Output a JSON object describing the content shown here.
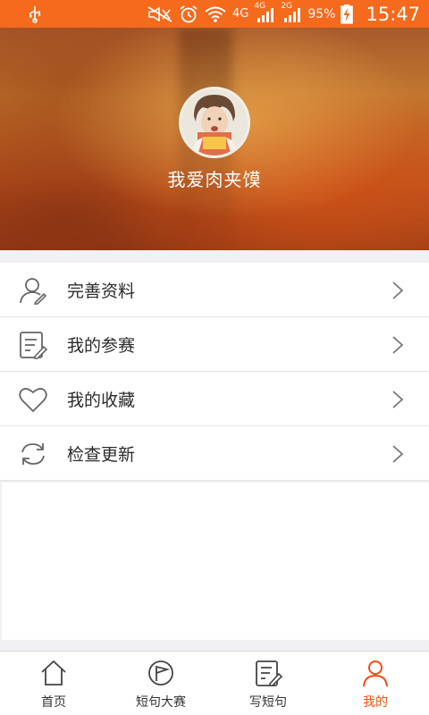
{
  "status_bar": {
    "network_4g_main": "4G",
    "sim1_label": "4G",
    "sim2_label": "2G",
    "battery": "95%",
    "time": "15:47",
    "color": "#f56a1c"
  },
  "profile": {
    "username": "我爱肉夹馍"
  },
  "menu": {
    "items": [
      {
        "label": "完善资料",
        "icon": "user-edit-icon"
      },
      {
        "label": "我的参赛",
        "icon": "note-edit-icon"
      },
      {
        "label": "我的收藏",
        "icon": "heart-icon"
      },
      {
        "label": "检查更新",
        "icon": "refresh-icon"
      }
    ]
  },
  "tabbar": {
    "active_color": "#f04f14",
    "tabs": [
      {
        "label": "首页",
        "icon": "home-icon"
      },
      {
        "label": "短句大赛",
        "icon": "flag-circle-icon"
      },
      {
        "label": "写短句",
        "icon": "write-icon"
      },
      {
        "label": "我的",
        "icon": "person-icon",
        "active": true
      }
    ]
  }
}
